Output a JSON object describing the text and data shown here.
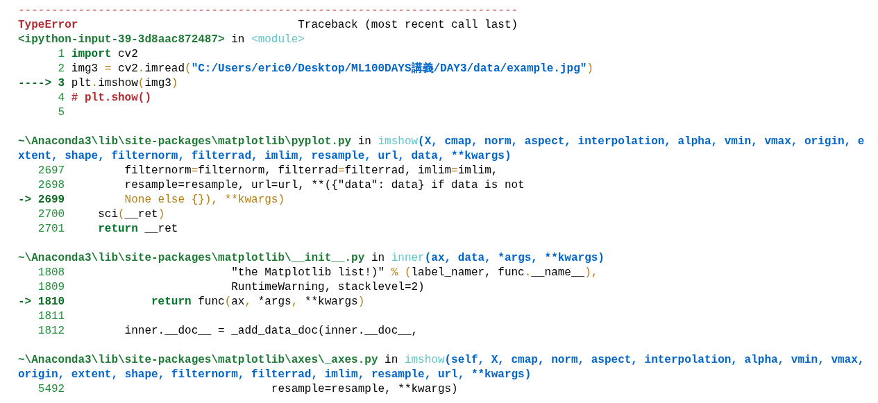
{
  "separator": "---------------------------------------------------------------------------",
  "error_heading": {
    "exception": "TypeError",
    "title": "Traceback (most recent call last)"
  },
  "frames": [
    {
      "location": [
        [
          {
            "kind": "file",
            "text": "<ipython-input-39-3d8aac872487>"
          },
          {
            "kind": "plain",
            "text": " in "
          },
          {
            "kind": "func",
            "text": "<module>"
          }
        ]
      ],
      "lines": [
        {
          "number": "1",
          "current": false,
          "segments": [
            {
              "kind": "keyword",
              "text": "import"
            },
            {
              "kind": "plain",
              "text": " cv2"
            }
          ]
        },
        {
          "number": "2",
          "current": false,
          "segments": [
            {
              "kind": "plain",
              "text": "img3 "
            },
            {
              "kind": "op",
              "text": "="
            },
            {
              "kind": "plain",
              "text": " cv2"
            },
            {
              "kind": "op",
              "text": "."
            },
            {
              "kind": "plain",
              "text": "imread"
            },
            {
              "kind": "op",
              "text": "("
            },
            {
              "kind": "string",
              "text": "\"C:/Users/eric0/Desktop/ML100DAYS講義/DAY3/data/example.jpg\""
            },
            {
              "kind": "op",
              "text": ")"
            }
          ]
        },
        {
          "number": "3",
          "current": true,
          "marker": "---->",
          "segments": [
            {
              "kind": "plain",
              "text": "plt"
            },
            {
              "kind": "op",
              "text": "."
            },
            {
              "kind": "plain",
              "text": "imshow"
            },
            {
              "kind": "op",
              "text": "("
            },
            {
              "kind": "plain",
              "text": "img3"
            },
            {
              "kind": "op",
              "text": ")"
            }
          ]
        },
        {
          "number": "4",
          "current": false,
          "segments": [
            {
              "kind": "comment",
              "text": "# plt.show()"
            }
          ]
        },
        {
          "number": "5",
          "current": false
        }
      ]
    },
    {
      "location": [
        [
          {
            "kind": "file",
            "text": "~\\Anaconda3\\lib\\site-packages\\matplotlib\\pyplot.py"
          },
          {
            "kind": "plain",
            "text": " in "
          },
          {
            "kind": "func",
            "text": "imshow"
          },
          {
            "kind": "args",
            "text": "(X, cmap, norm, aspect, interpolation, alpha, vmin, vmax, origin, e"
          }
        ],
        [
          {
            "kind": "args",
            "text": "xtent, shape, filternorm, filterrad, imlim, resample, url, data, **kwargs)"
          }
        ]
      ],
      "lines": [
        {
          "number": "2697",
          "current": false,
          "segments": [
            {
              "kind": "plain",
              "text": "filternorm"
            },
            {
              "kind": "op",
              "text": "="
            },
            {
              "kind": "plain",
              "text": "filternorm, filterrad"
            },
            {
              "kind": "op",
              "text": "="
            },
            {
              "kind": "plain",
              "text": "filterrad, imlim"
            },
            {
              "kind": "op",
              "text": "="
            },
            {
              "kind": "plain",
              "text": "imlim,"
            }
          ]
        },
        {
          "number": "2698",
          "current": false,
          "segments": [
            {
              "kind": "plain",
              "text": "resample=resample, url=url, **({\"data\": data} if data is not"
            }
          ]
        },
        {
          "number": "2699",
          "current": true,
          "marker": "->",
          "segments": [
            {
              "kind": "op",
              "text": "None else {}), **kwargs)"
            }
          ]
        },
        {
          "number": "2700",
          "current": false,
          "segments": [
            {
              "kind": "plain",
              "text": "sci"
            },
            {
              "kind": "op",
              "text": "("
            },
            {
              "kind": "plain",
              "text": "__ret"
            },
            {
              "kind": "op",
              "text": ")"
            }
          ]
        },
        {
          "number": "2701",
          "current": false,
          "segments": [
            {
              "kind": "keyword",
              "text": "return"
            },
            {
              "kind": "plain",
              "text": " __ret"
            }
          ]
        }
      ]
    },
    {
      "location": [
        [
          {
            "kind": "file",
            "text": "~\\Anaconda3\\lib\\site-packages\\matplotlib\\__init__.py"
          },
          {
            "kind": "plain",
            "text": " in "
          },
          {
            "kind": "func",
            "text": "inner"
          },
          {
            "kind": "args",
            "text": "(ax, data, *args, **kwargs)"
          }
        ]
      ],
      "lines": [
        {
          "number": "1808",
          "current": false,
          "segments": [
            {
              "kind": "plain",
              "text": "\"the Matplotlib list!)\" "
            },
            {
              "kind": "op",
              "text": "% ("
            },
            {
              "kind": "plain",
              "text": "label_namer, func"
            },
            {
              "kind": "op",
              "text": "."
            },
            {
              "kind": "plain",
              "text": "__name__"
            },
            {
              "kind": "op",
              "text": "),"
            }
          ]
        },
        {
          "number": "1809",
          "current": false,
          "segments": [
            {
              "kind": "plain",
              "text": "RuntimeWarning, stacklevel=2)"
            }
          ]
        },
        {
          "number": "1810",
          "current": true,
          "marker": "->",
          "segments": [
            {
              "kind": "keyword",
              "text": "return"
            },
            {
              "kind": "plain",
              "text": " func"
            },
            {
              "kind": "op",
              "text": "("
            },
            {
              "kind": "plain",
              "text": "ax"
            },
            {
              "kind": "op",
              "text": ","
            },
            {
              "kind": "plain",
              "text": " *args"
            },
            {
              "kind": "op",
              "text": ","
            },
            {
              "kind": "plain",
              "text": " **kwargs"
            },
            {
              "kind": "op",
              "text": ")"
            }
          ]
        },
        {
          "number": "1811",
          "current": false
        },
        {
          "number": "1812",
          "current": false,
          "segments": [
            {
              "kind": "plain",
              "text": "inner.__doc__ = _add_data_doc(inner.__doc__,"
            }
          ]
        }
      ]
    },
    {
      "location": [
        [
          {
            "kind": "file",
            "text": "~\\Anaconda3\\lib\\site-packages\\matplotlib\\axes\\_axes.py"
          },
          {
            "kind": "plain",
            "text": " in "
          },
          {
            "kind": "func",
            "text": "imshow"
          },
          {
            "kind": "args",
            "text": "(self, X, cmap, norm, aspect, interpolation, alpha, vmin, vmax,"
          }
        ],
        [
          {
            "kind": "args",
            "text": "origin, extent, shape, filternorm, filterrad, imlim, resample, url, **kwargs)"
          }
        ]
      ],
      "lines": [
        {
          "number": "5492",
          "current": false,
          "segments": [
            {
              "kind": "plain",
              "text": "resample=resample, **kwargs)"
            }
          ]
        }
      ]
    }
  ]
}
